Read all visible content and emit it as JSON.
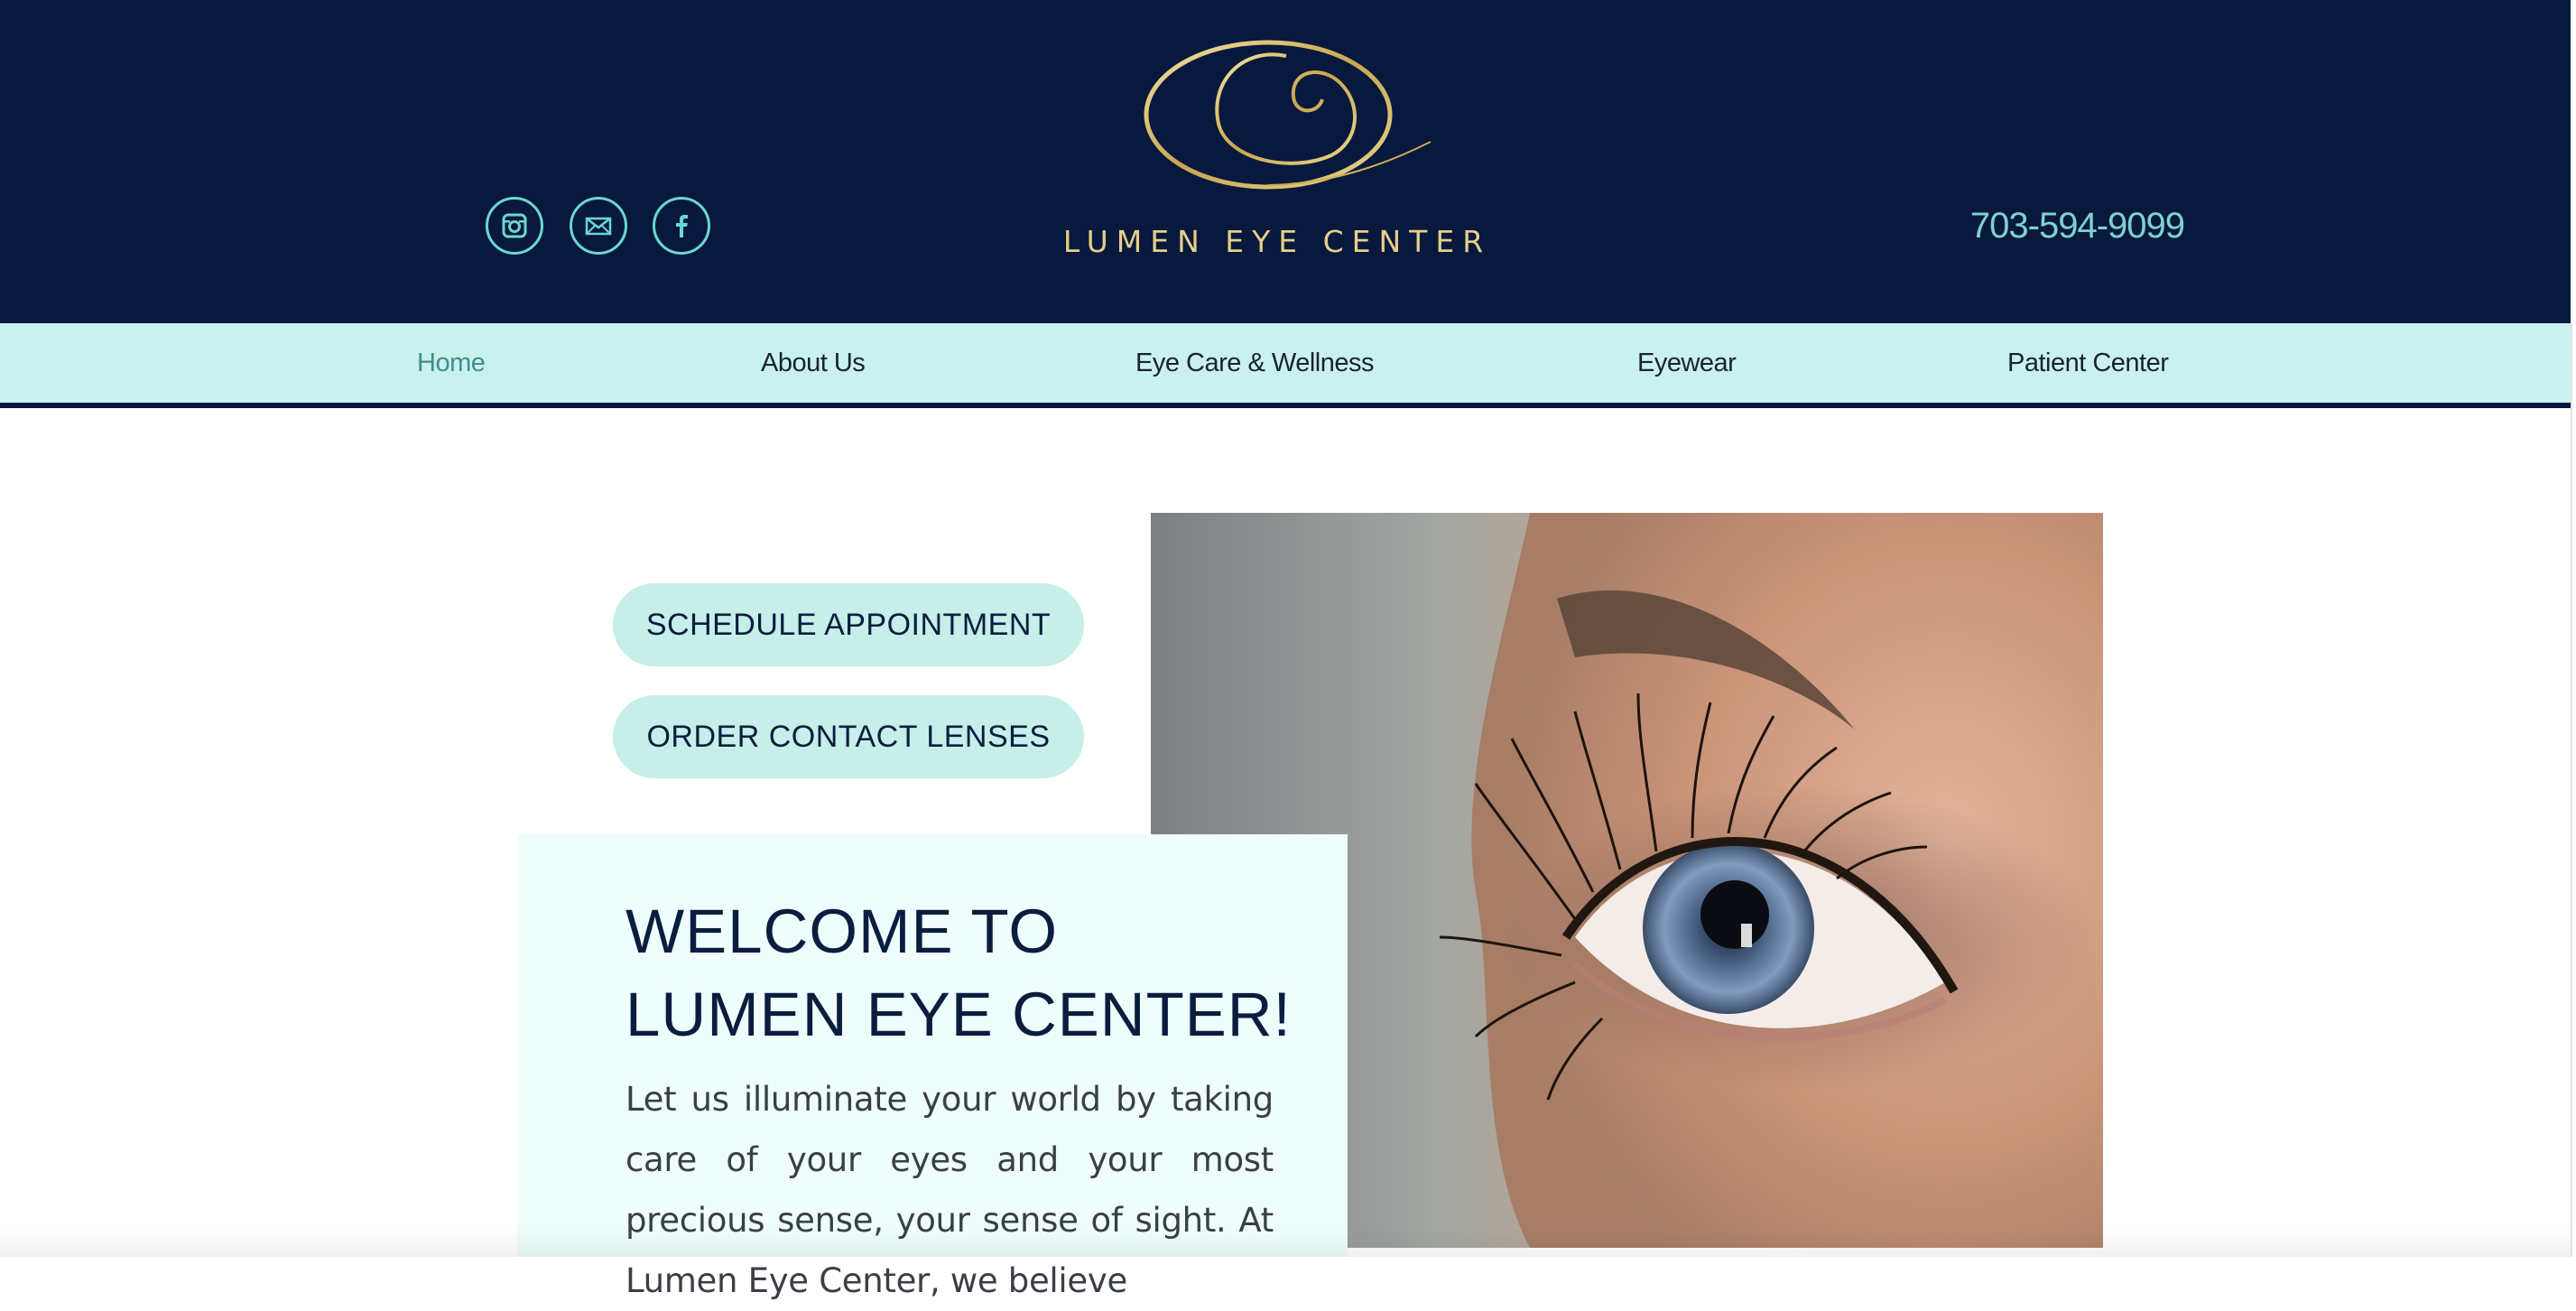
{
  "header": {
    "brand_name": "LUMEN EYE CENTER",
    "phone": "703-594-9099",
    "social_icons": [
      "instagram-icon",
      "email-icon",
      "facebook-icon"
    ]
  },
  "nav": {
    "items": [
      {
        "label": "Home",
        "active": true
      },
      {
        "label": "About Us",
        "active": false
      },
      {
        "label": "Eye Care & Wellness",
        "active": false
      },
      {
        "label": "Eyewear",
        "active": false
      },
      {
        "label": "Patient Center",
        "active": false
      }
    ]
  },
  "actions": {
    "schedule_label": "SCHEDULE APPOINTMENT",
    "order_label": "ORDER CONTACT LENSES"
  },
  "welcome": {
    "title_line1": "WELCOME TO",
    "title_line2": "LUMEN EYE CENTER!",
    "body": "Let us illuminate your world by taking care of your eyes and your most precious sense, your sense of sight. At Lumen Eye Center, we believe"
  },
  "colors": {
    "header_bg": "#09193d",
    "nav_bg": "#c9f1ee",
    "accent_gold": "#e6cf88",
    "accent_teal": "#6ad7d2",
    "button_bg": "#c5efe8",
    "card_bg": "#effefd"
  }
}
